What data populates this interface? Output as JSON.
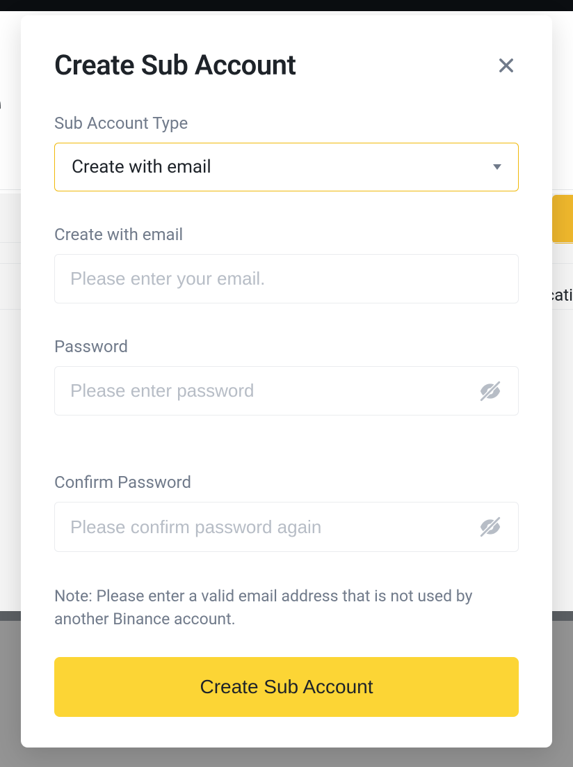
{
  "modal": {
    "title": "Create Sub Account",
    "typeLabel": "Sub Account Type",
    "typeSelected": "Create with email",
    "emailLabel": "Create with email",
    "emailPlaceholder": "Please enter your email.",
    "passwordLabel": "Password",
    "passwordPlaceholder": "Please enter password",
    "confirmLabel": "Confirm Password",
    "confirmPlaceholder": "Please confirm password again",
    "note": "Note: Please enter a valid email address that is not used by another Binance account.",
    "submitLabel": "Create Sub Account"
  }
}
